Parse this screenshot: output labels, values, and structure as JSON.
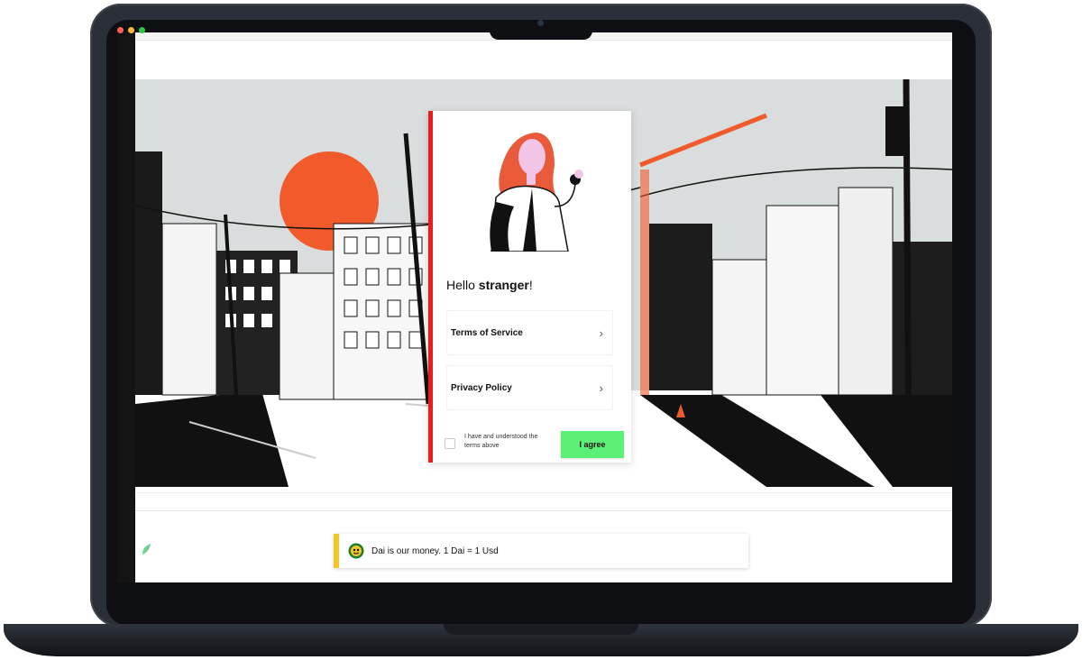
{
  "modal": {
    "greeting_prefix": "Hello ",
    "greeting_name": "stranger",
    "greeting_suffix": "!",
    "items": [
      {
        "label": "Terms of Service"
      },
      {
        "label": "Privacy Policy"
      }
    ],
    "checkbox_label": "I have and understood the terms above",
    "agree_button": "I agree",
    "chevron": "›"
  },
  "notification": {
    "text": "Dai is our money. 1 Dai = 1 Usd",
    "icon": "dai-coin-icon"
  },
  "colors": {
    "modal_accent": "#ea1d1d",
    "agree_button": "#5cf078",
    "notification_accent": "#f2c52b",
    "sun": "#f15a2b"
  }
}
